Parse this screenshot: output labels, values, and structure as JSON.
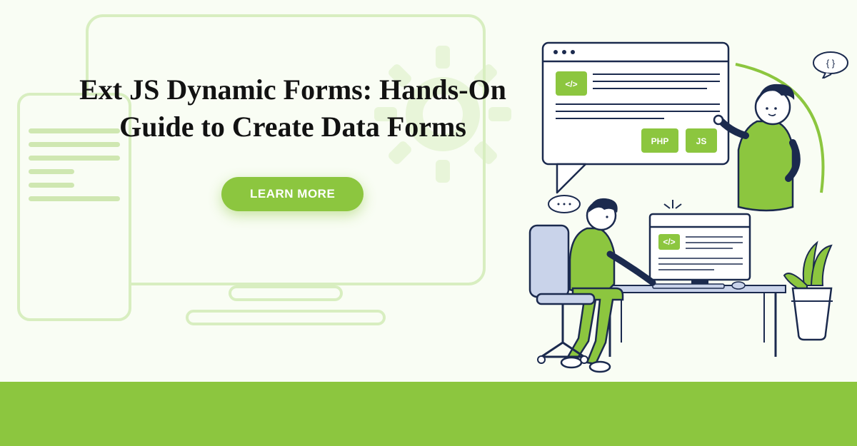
{
  "headline": "Ext JS Dynamic Forms: Hands-On Guide to Create Data Forms",
  "cta_label": "LEARN MORE",
  "illustration": {
    "browser_tags": {
      "code_icon": "</>",
      "php": "PHP",
      "js": "JS"
    },
    "code_bubble": "{ }"
  },
  "colors": {
    "accent": "#8cc63f",
    "accent_light": "#d8eec0",
    "ink": "#1b2a4e",
    "bg": "#f9fdf4"
  }
}
